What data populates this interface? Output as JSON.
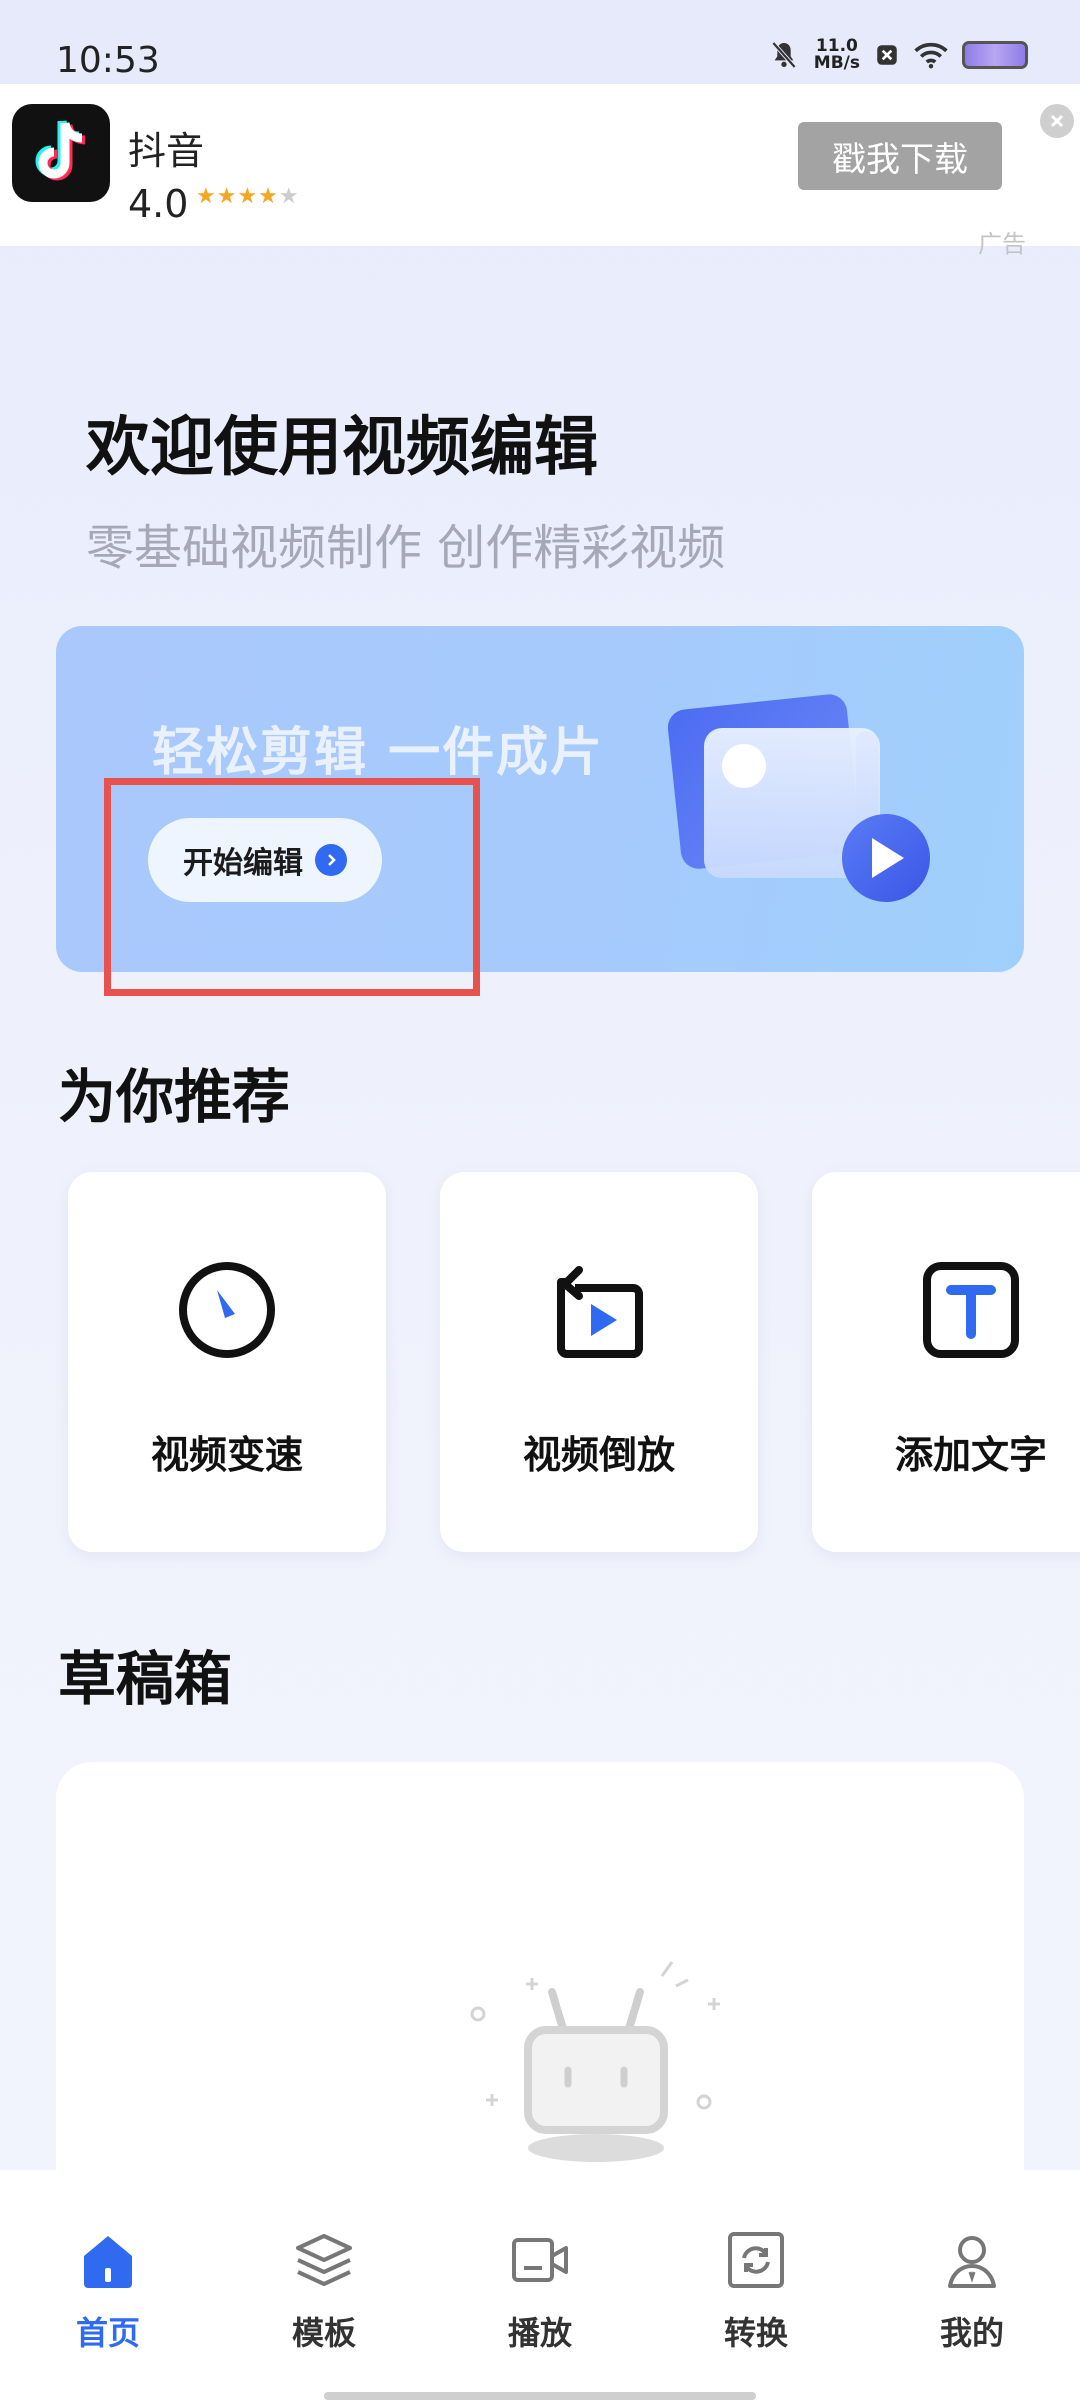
{
  "status_bar": {
    "time": "10:53",
    "speed_value": "11.0",
    "speed_unit": "MB/s"
  },
  "ad": {
    "app_name": "抖音",
    "rating": "4.0",
    "stars_filled": "★★★★",
    "stars_empty": "★",
    "cta": "戳我下载",
    "label": "广告"
  },
  "welcome": {
    "title": "欢迎使用视频编辑",
    "subtitle": "零基础视频制作 创作精彩视频"
  },
  "hero": {
    "slogan": "轻松剪辑 一件成片",
    "button_label": "开始编辑"
  },
  "recommend": {
    "title": "为你推荐",
    "items": [
      {
        "label": "视频变速",
        "icon": "speed-gauge-icon"
      },
      {
        "label": "视频倒放",
        "icon": "reverse-play-icon"
      },
      {
        "label": "添加文字",
        "icon": "text-t-icon"
      }
    ]
  },
  "drafts": {
    "title": "草稿箱"
  },
  "nav": {
    "items": [
      {
        "label": "首页",
        "icon": "home-icon",
        "active": true
      },
      {
        "label": "模板",
        "icon": "layers-icon"
      },
      {
        "label": "播放",
        "icon": "video-camera-icon"
      },
      {
        "label": "转换",
        "icon": "convert-icon"
      },
      {
        "label": "我的",
        "icon": "user-icon"
      }
    ]
  },
  "colors": {
    "accent": "#2f6af0",
    "highlight": "#e8524e",
    "cta_gray": "#a3a3a3"
  }
}
